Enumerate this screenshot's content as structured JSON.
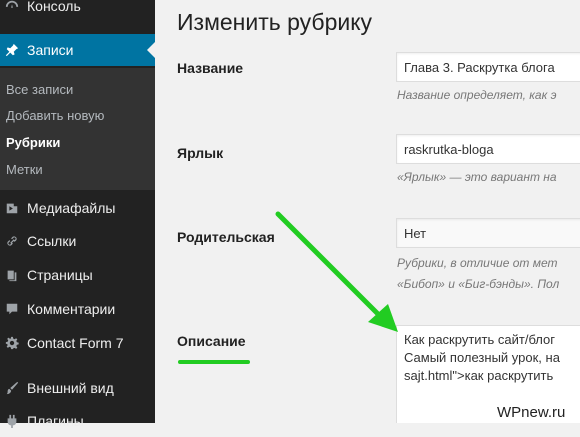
{
  "sidebar": {
    "items": [
      {
        "label": "Консоль",
        "icon": "dashboard-icon"
      },
      {
        "label": "Записи",
        "icon": "pin-icon"
      },
      {
        "label": "Медиафайлы",
        "icon": "media-icon"
      },
      {
        "label": "Ссылки",
        "icon": "link-icon"
      },
      {
        "label": "Страницы",
        "icon": "page-icon"
      },
      {
        "label": "Комментарии",
        "icon": "comment-icon"
      },
      {
        "label": "Contact Form 7",
        "icon": "gear-icon"
      },
      {
        "label": "Внешний вид",
        "icon": "brush-icon"
      },
      {
        "label": "Плагины",
        "icon": "plugin-icon"
      }
    ],
    "submenu": [
      "Все записи",
      "Добавить новую",
      "Рубрики",
      "Метки"
    ]
  },
  "main": {
    "title": "Изменить рубрику",
    "name": {
      "label": "Название",
      "value": "Глава 3. Раскрутка блога",
      "hint": "Название определяет, как э"
    },
    "slug": {
      "label": "Ярлык",
      "value": "raskrutka-bloga",
      "hint": "«Ярлык» — это вариант на"
    },
    "parent": {
      "label": "Родительская",
      "value": "Нет",
      "hint_line1": "Рубрики, в отличие от мет",
      "hint_line2": "«Бибоп» и «Биг-бэнды». Пол"
    },
    "description": {
      "label": "Описание",
      "value": "Как раскрутить сайт/блог\nСамый полезный урок, на\nsajt.html\">как раскрутить"
    }
  },
  "watermark": "WPnew.ru",
  "colors": {
    "sidebar_bg": "#222222",
    "active": "#0074a2",
    "annotation": "#22cc22"
  }
}
